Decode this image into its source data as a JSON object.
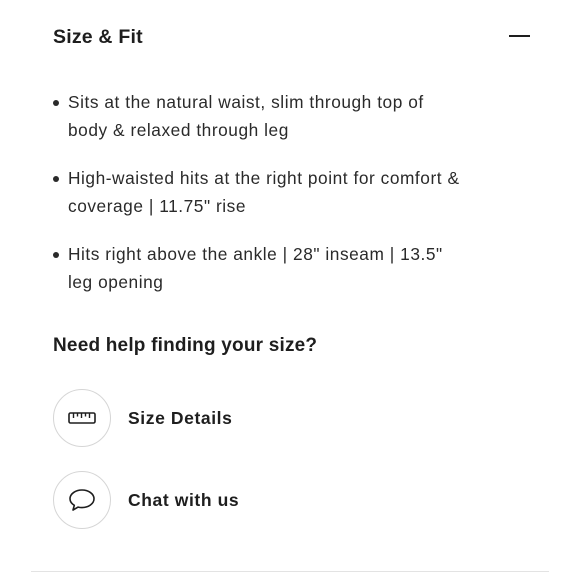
{
  "section": {
    "title": "Size & Fit",
    "toggle_icon": "minus-icon"
  },
  "fit_details": [
    {
      "line1": "Sits at the natural waist, slim through top of",
      "line2": "body & relaxed through leg"
    },
    {
      "line1": "High-waisted hits at the right point for comfort &",
      "line2": "coverage | 11.75\" rise"
    },
    {
      "line1": "Hits right above the ankle | 28\" inseam | 13.5\"",
      "line2": "leg opening"
    }
  ],
  "help": {
    "heading": "Need help finding your size?",
    "links": [
      {
        "label": "Size Details",
        "icon": "ruler-icon"
      },
      {
        "label": "Chat with us",
        "icon": "chat-bubble-icon"
      }
    ]
  },
  "colors": {
    "text": "#1e1e1e",
    "circle_border": "#d6d6d6",
    "divider": "#e3e3e3"
  }
}
